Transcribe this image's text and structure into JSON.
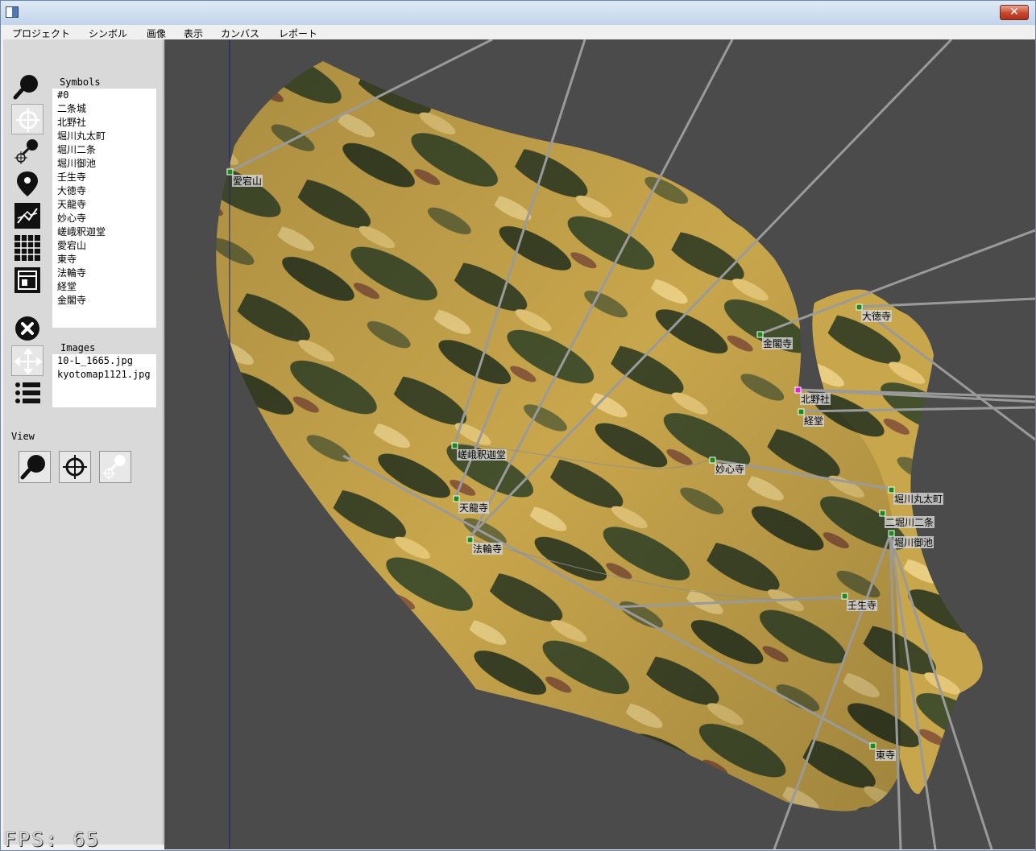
{
  "menu": [
    "プロジェクト",
    "シンボル",
    "画像",
    "表示",
    "カンバス",
    "レポート"
  ],
  "window": {
    "close_glyph": "✕"
  },
  "panel": {
    "symbols_heading": "Symbols",
    "symbols": [
      "#0",
      "二条城",
      "北野社",
      "堀川丸太町",
      "堀川二条",
      "堀川御池",
      "壬生寺",
      "大徳寺",
      "天龍寺",
      "妙心寺",
      "嵯峨釈迦堂",
      "愛宕山",
      "東寺",
      "法輪寺",
      "経堂",
      "金閣寺"
    ],
    "images_heading": "Images",
    "images": [
      "10-L_1665.jpg",
      "kyotomap1121.jpg"
    ],
    "view_heading": "View"
  },
  "tools": [
    "zoom-tool-icon",
    "crosshair-tool-icon",
    "point-zoom-tool-icon",
    "place-marker-icon",
    "line-chart-icon",
    "grid-icon",
    "layout-icon",
    "delete-icon",
    "move-icon",
    "list-icon"
  ],
  "view_tools": [
    "zoom-view-icon",
    "crosshair-view-icon",
    "point-view-icon"
  ],
  "map_markers": [
    {
      "label": "愛宕山",
      "color": "#1a8a1a"
    },
    {
      "label": "金閣寺",
      "color": "#1a8a1a"
    },
    {
      "label": "大徳寺",
      "color": "#1a8a1a"
    },
    {
      "label": "北野社",
      "color": "#e020e0"
    },
    {
      "label": "経堂",
      "color": "#1a8a1a"
    },
    {
      "label": "嵯峨釈迦堂",
      "color": "#1a8a1a"
    },
    {
      "label": "妙心寺",
      "color": "#1a8a1a"
    },
    {
      "label": "天龍寺",
      "color": "#1a8a1a"
    },
    {
      "label": "堀川丸太町",
      "color": "#1a8a1a"
    },
    {
      "label": "二堀川二条",
      "color": "#1a8a1a"
    },
    {
      "label": "堀川御池",
      "color": "#1a8a1a"
    },
    {
      "label": "法輪寺",
      "color": "#1a8a1a"
    },
    {
      "label": "壬生寺",
      "color": "#1a8a1a"
    },
    {
      "label": "東寺",
      "color": "#1a8a1a"
    }
  ],
  "fps_text": "FPS: 65",
  "colors": {
    "canvas_bg": "#4b4b4b",
    "map_tan": "#c9a84f",
    "map_dark": "#3d4426",
    "ray": "#9a9a9a"
  }
}
